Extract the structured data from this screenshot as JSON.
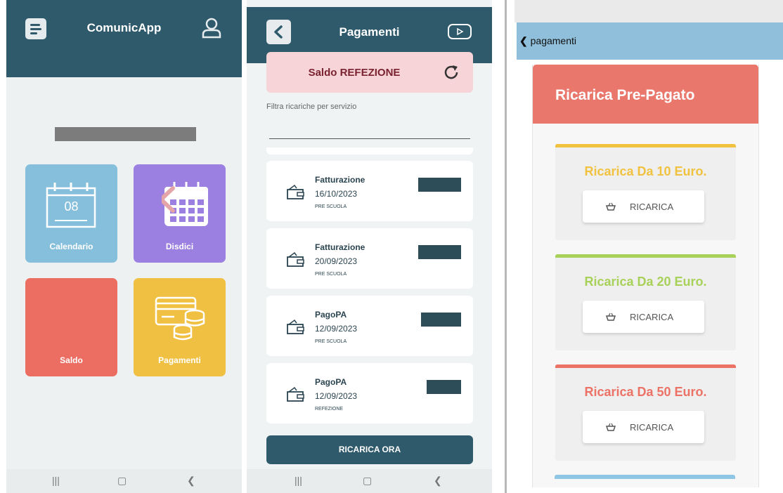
{
  "screen1": {
    "app_title": "ComunicApp",
    "tiles": [
      {
        "label": "Calendario",
        "icon": "calendar-icon",
        "day": "08",
        "color": "#86bfdc"
      },
      {
        "label": "Disdici",
        "icon": "cancel-calendar-icon",
        "color": "#9b7fe1"
      },
      {
        "label": "Saldo",
        "color": "#ec6d62"
      },
      {
        "label": "Pagamenti",
        "icon": "cards-coins-icon",
        "color": "#f0c043"
      }
    ],
    "header_color": "#2f5a6b"
  },
  "screen2": {
    "title": "Pagamenti",
    "saldo_label": "Saldo REFEZIONE",
    "filter_label": "Filtra ricariche per servizio",
    "payments": [
      {
        "type": "Fatturazione",
        "date": "16/10/2023",
        "service": "PRE SCUOLA"
      },
      {
        "type": "Fatturazione",
        "date": "20/09/2023",
        "service": "PRE SCUOLA"
      },
      {
        "type": "PagoPA",
        "date": "12/09/2023",
        "service": "PRE SCUOLA"
      },
      {
        "type": "PagoPA",
        "date": "12/09/2023",
        "service": "REFEZIONE"
      }
    ],
    "recharge_button": "RICARICA ORA"
  },
  "screen3": {
    "back_label": "pagamenti",
    "header_title": "Ricarica Pre-Pagato",
    "options": [
      {
        "title": "Ricarica Da 10 Euro.",
        "button": "RICARICA",
        "color": "#f0c23f"
      },
      {
        "title": "Ricarica Da 20 Euro.",
        "button": "RICARICA",
        "color": "#a8d15a"
      },
      {
        "title": "Ricarica Da 50 Euro.",
        "button": "RICARICA",
        "color": "#ec7266"
      }
    ]
  }
}
